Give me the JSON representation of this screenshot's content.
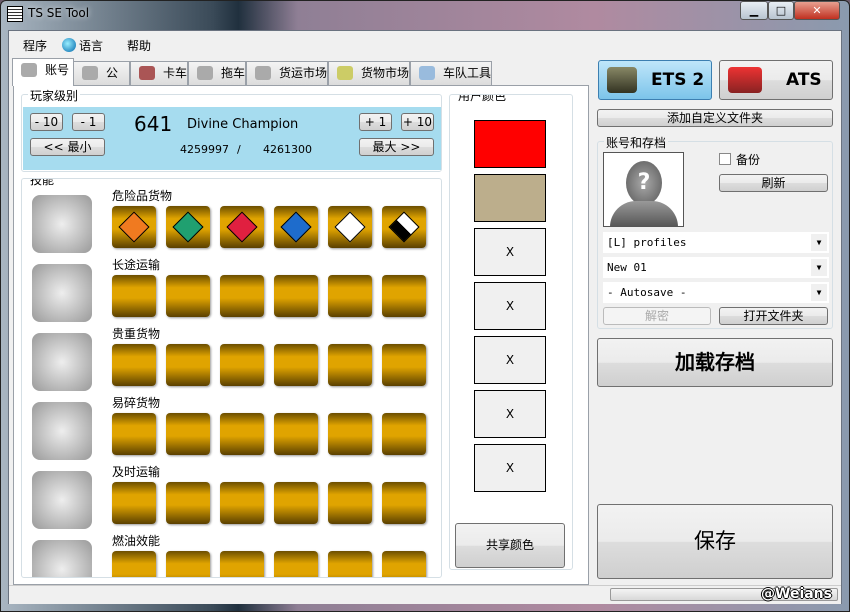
{
  "window": {
    "title": "TS SE Tool",
    "minimize": "▁",
    "maximize": "□",
    "close": "✕"
  },
  "menu": {
    "program": "程序",
    "language": "语言",
    "help": "帮助"
  },
  "tabs": [
    {
      "label": "账号"
    },
    {
      "label": "公司"
    },
    {
      "label": "卡车"
    },
    {
      "label": "拖车"
    },
    {
      "label": "货运市场"
    },
    {
      "label": "货物市场"
    },
    {
      "label": "车队工具"
    }
  ],
  "player_level": {
    "title": "玩家级别",
    "minus10": "- 10",
    "minus1": "- 1",
    "plus1": "+ 1",
    "plus10": "+ 10",
    "min": "<< 最小",
    "max": "最大 >>",
    "level": "641",
    "rank": "Divine Champion",
    "xp": "4259997",
    "xp_sep": "/",
    "xp_next": "4261300"
  },
  "skills": {
    "title": "技能",
    "rows": [
      {
        "label": "危险品货物",
        "level": 6
      },
      {
        "label": "长途运输",
        "level": 0
      },
      {
        "label": "贵重货物",
        "level": 0
      },
      {
        "label": "易碎货物",
        "level": 0
      },
      {
        "label": "及时运输",
        "level": 0
      },
      {
        "label": "燃油效能",
        "level": 0
      }
    ],
    "adr_colors": [
      "#f07a20",
      "#20a070",
      "#e02040",
      "#1e6ccc",
      "#ffffff",
      "#ffffff"
    ]
  },
  "user_colors": {
    "title": "用户颜色",
    "swatches": [
      {
        "color": "#ff0000",
        "text": ""
      },
      {
        "color": "#bcae8c",
        "text": ""
      },
      {
        "color": "",
        "text": "X"
      },
      {
        "color": "",
        "text": "X"
      },
      {
        "color": "",
        "text": "X"
      },
      {
        "color": "",
        "text": "X"
      },
      {
        "color": "",
        "text": "X"
      }
    ],
    "share": "共享颜色"
  },
  "games": {
    "ets2": "ETS 2",
    "ats": "ATS",
    "selected": "ETS 2"
  },
  "add_folder": "添加自定义文件夹",
  "profile": {
    "title": "账号和存档",
    "backup": "备份",
    "backup_checked": false,
    "refresh": "刷新",
    "folder": "[L] profiles",
    "profile_name": "New 01",
    "save": "- Autosave -",
    "decrypt": "解密",
    "open_folder": "打开文件夹"
  },
  "load": "加载存档",
  "save": "保存",
  "status": {
    "progress": 0,
    "watermark": "@Weians"
  }
}
